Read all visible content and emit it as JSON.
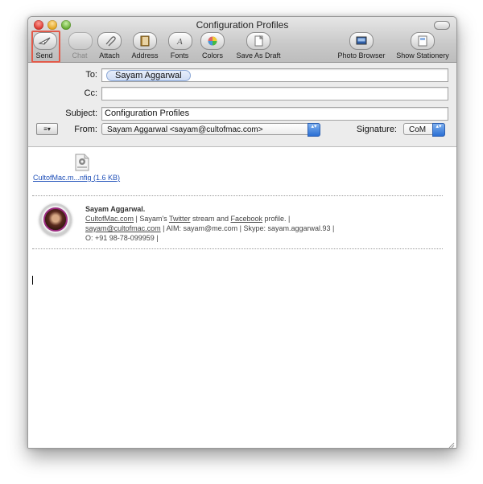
{
  "window": {
    "title": "Configuration Profiles"
  },
  "toolbar": {
    "items": [
      {
        "label": "Send",
        "icon": "send-icon"
      },
      {
        "label": "Chat",
        "icon": "chat-icon"
      },
      {
        "label": "Attach",
        "icon": "paperclip-icon"
      },
      {
        "label": "Address",
        "icon": "address-book-icon"
      },
      {
        "label": "Fonts",
        "icon": "fonts-icon"
      },
      {
        "label": "Colors",
        "icon": "color-wheel-icon"
      },
      {
        "label": "Save As Draft",
        "icon": "draft-icon"
      },
      {
        "label": "Photo Browser",
        "icon": "photo-browser-icon"
      },
      {
        "label": "Show Stationery",
        "icon": "stationery-icon"
      }
    ]
  },
  "headers": {
    "to_label": "To:",
    "to_recipient": "Sayam Aggarwal",
    "cc_label": "Cc:",
    "cc_value": "",
    "subject_label": "Subject:",
    "subject_value": "Configuration Profiles",
    "menu_glyph": "≡▾",
    "from_label": "From:",
    "from_value": "Sayam Aggarwal <sayam@cultofmac.com>",
    "signature_label": "Signature:",
    "signature_value": "CoM",
    "stepper_glyph": "▴▾"
  },
  "body": {
    "attachment_name": "CultofMac.m...nfig (1.6 KB)",
    "signature": {
      "name": "Sayam Aggarwal.",
      "line2_a": "CultofMac.com",
      "line2_b": " | Sayam's ",
      "line2_c": "Twitter",
      "line2_d": " stream and ",
      "line2_e": "Facebook",
      "line2_f": " profile. |",
      "line3_a": "sayam@cultofmac.com",
      "line3_b": " | AIM: sayam@me.com | Skype: sayam.aggarwal.93 |",
      "line4": "O: +91 98-78-099959 |"
    }
  },
  "colors": {
    "send_highlight": "#e25a4a",
    "link": "#1e4fb8",
    "stepper_blue": "#2b6fd3"
  }
}
